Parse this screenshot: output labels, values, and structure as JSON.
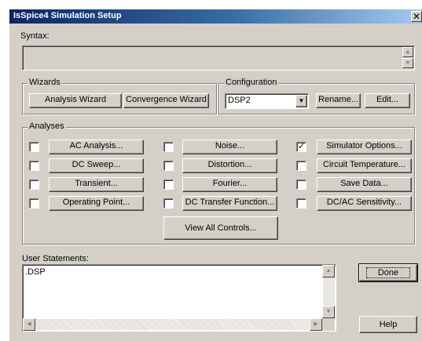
{
  "window": {
    "title": "IsSpice4 Simulation Setup",
    "close_glyph": "✕"
  },
  "syntax": {
    "label": "Syntax:",
    "value": ""
  },
  "wizards": {
    "group_label": "Wizards",
    "analysis_wizard": "Analysis Wizard",
    "convergence_wizard": "Convergence Wizard"
  },
  "configuration": {
    "group_label": "Configuration",
    "selected": "DSP2",
    "rename": "Rename...",
    "edit": "Edit..."
  },
  "analyses": {
    "group_label": "Analyses",
    "col1": [
      {
        "label": "AC Analysis...",
        "checked": false
      },
      {
        "label": "DC Sweep...",
        "checked": false
      },
      {
        "label": "Transient...",
        "checked": false
      },
      {
        "label": "Operating Point...",
        "checked": false
      }
    ],
    "col2": [
      {
        "label": "Noise...",
        "checked": false
      },
      {
        "label": "Distortion...",
        "checked": false
      },
      {
        "label": "Fourier...",
        "checked": false
      },
      {
        "label": "DC Transfer Function...",
        "checked": false
      }
    ],
    "col3": [
      {
        "label": "Simulator Options...",
        "checked": true
      },
      {
        "label": "Circuit Temperature...",
        "checked": false
      },
      {
        "label": "Save Data...",
        "checked": false
      },
      {
        "label": "DC/AC Sensitivity...",
        "checked": false
      }
    ],
    "view_all": "View All Controls..."
  },
  "user_statements": {
    "label": "User Statements:",
    "text": ".DSP"
  },
  "footer": {
    "done": "Done",
    "help": "Help"
  },
  "icons": {
    "close": "close-icon",
    "dropdown": "dropdown-arrow-icon",
    "checkmark": "checkmark-icon",
    "scroll_up": "scroll-up-arrow-icon",
    "scroll_down": "scroll-down-arrow-icon",
    "scroll_left": "scroll-left-arrow-icon",
    "scroll_right": "scroll-right-arrow-icon"
  }
}
